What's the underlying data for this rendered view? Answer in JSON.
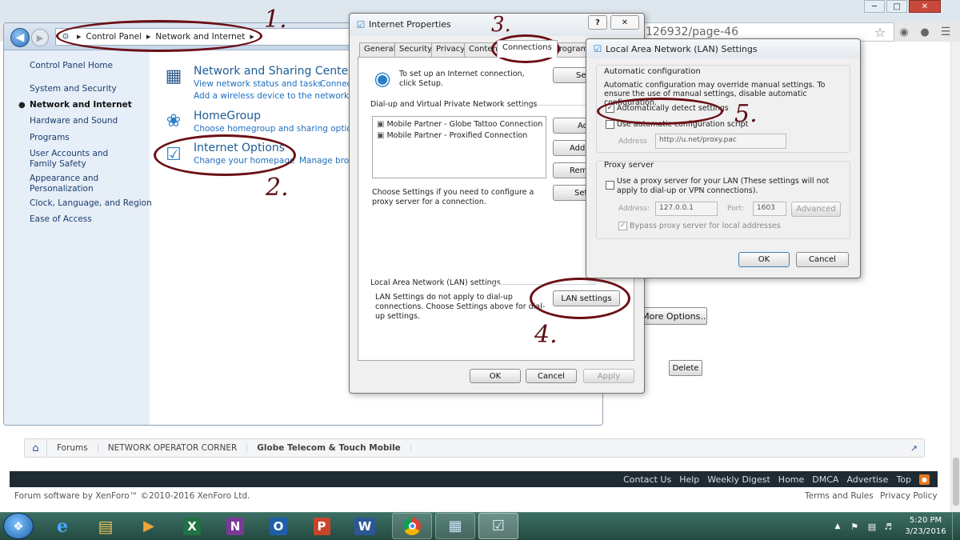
{
  "browser": {
    "url_tail": "126932/page-46",
    "colors": {
      "chrome": "#dfe7ee",
      "page": "#ffffff",
      "footer_bar": "#1f2b33",
      "taskbar": "#2b5a4f"
    }
  },
  "control_panel": {
    "breadcrumb": [
      "Control Panel",
      "Network and Internet"
    ],
    "sidebar": {
      "items": [
        {
          "label": "Control Panel Home",
          "active": false
        },
        {
          "label": "System and Security",
          "active": false
        },
        {
          "label": "Network and Internet",
          "active": true
        },
        {
          "label": "Hardware and Sound",
          "active": false
        },
        {
          "label": "Programs",
          "active": false
        },
        {
          "label": "User Accounts and Family Safety",
          "active": false
        },
        {
          "label": "Appearance and Personalization",
          "active": false
        },
        {
          "label": "Clock, Language, and Region",
          "active": false
        },
        {
          "label": "Ease of Access",
          "active": false
        }
      ]
    },
    "sections": [
      {
        "title": "Network and Sharing Center",
        "links": [
          "View network status and tasks",
          "Connec",
          "Add a wireless device to the network"
        ],
        "icon": "network-icon"
      },
      {
        "title": "HomeGroup",
        "links": [
          "Choose homegroup and sharing options"
        ],
        "icon": "homegroup-icon"
      },
      {
        "title": "Internet Options",
        "links": [
          "Change your homepage",
          "Manage brow"
        ],
        "icon": "internet-options-icon"
      }
    ]
  },
  "internet_properties": {
    "title": "Internet Properties",
    "tabs": [
      "General",
      "Security",
      "Privacy",
      "Content",
      "Connections",
      "Programs"
    ],
    "active_tab": "Connections",
    "setup_text": "To set up an Internet connection, click Setup.",
    "setup_button": "Se",
    "vpn_heading": "Dial-up and Virtual Private Network settings",
    "vpn_list": [
      "Mobile Partner - Globe Tattoo Connection",
      "Mobile Partner - Proxified Connection"
    ],
    "add_button": "Ad",
    "add_vpn_button": "Add",
    "remove_button": "Remo",
    "settings_button": "Set",
    "settings_text": "Choose Settings if you need to configure a proxy server for a connection.",
    "lan_heading": "Local Area Network (LAN) settings",
    "lan_text": "LAN Settings do not apply to dial-up connections. Choose Settings above for dial-up settings.",
    "lan_button": "LAN settings",
    "ok": "OK",
    "cancel": "Cancel",
    "apply": "Apply"
  },
  "lan_dialog": {
    "title": "Local Area Network (LAN) Settings",
    "auto_heading": "Automatic configuration",
    "auto_text": "Automatic configuration may override manual settings.  To ensure the use of manual settings, disable automatic configuration.",
    "auto_detect": {
      "label": "Automatically detect settings",
      "checked": true
    },
    "use_script": {
      "label": "Use automatic configuration script",
      "checked": false
    },
    "address_label": "Address",
    "address_value": "http://u.net/proxy.pac",
    "proxy_heading": "Proxy server",
    "use_proxy": {
      "label": "Use a proxy server for your LAN (These settings will not apply to dial-up or VPN connections).",
      "checked": false
    },
    "proxy_address_label": "Address:",
    "proxy_address_value": "127.0.0.1",
    "port_label": "Port:",
    "port_value": "1603",
    "advanced": "Advanced",
    "bypass": {
      "label": "Bypass proxy server for local addresses",
      "checked": true
    },
    "ok": "OK",
    "cancel": "Cancel"
  },
  "forum_behind": {
    "more_options": "More Options...",
    "delete": "Delete"
  },
  "forum": {
    "breadcrumb": [
      "Forums",
      "NETWORK OPERATOR CORNER",
      "Globe Telecom & Touch Mobile"
    ],
    "footer_links": [
      "Contact Us",
      "Help",
      "Weekly Digest",
      "Home",
      "DMCA",
      "Advertise",
      "Top"
    ],
    "copyright": "Forum software by XenForo™ ©2010-2016 XenForo Ltd.",
    "terms": "Terms and Rules",
    "privacy": "Privacy Policy"
  },
  "annotations": [
    "1.",
    "2.",
    "3.",
    "4.",
    "5."
  ],
  "taskbar": {
    "time": "5:20 PM",
    "date": "3/23/2016",
    "apps": [
      "Start",
      "Internet Explorer",
      "Windows Explorer",
      "Media Player",
      "Excel",
      "OneNote",
      "Outlook",
      "PowerPoint",
      "Word",
      "Chrome",
      "Control Panel",
      "Internet Options"
    ]
  }
}
